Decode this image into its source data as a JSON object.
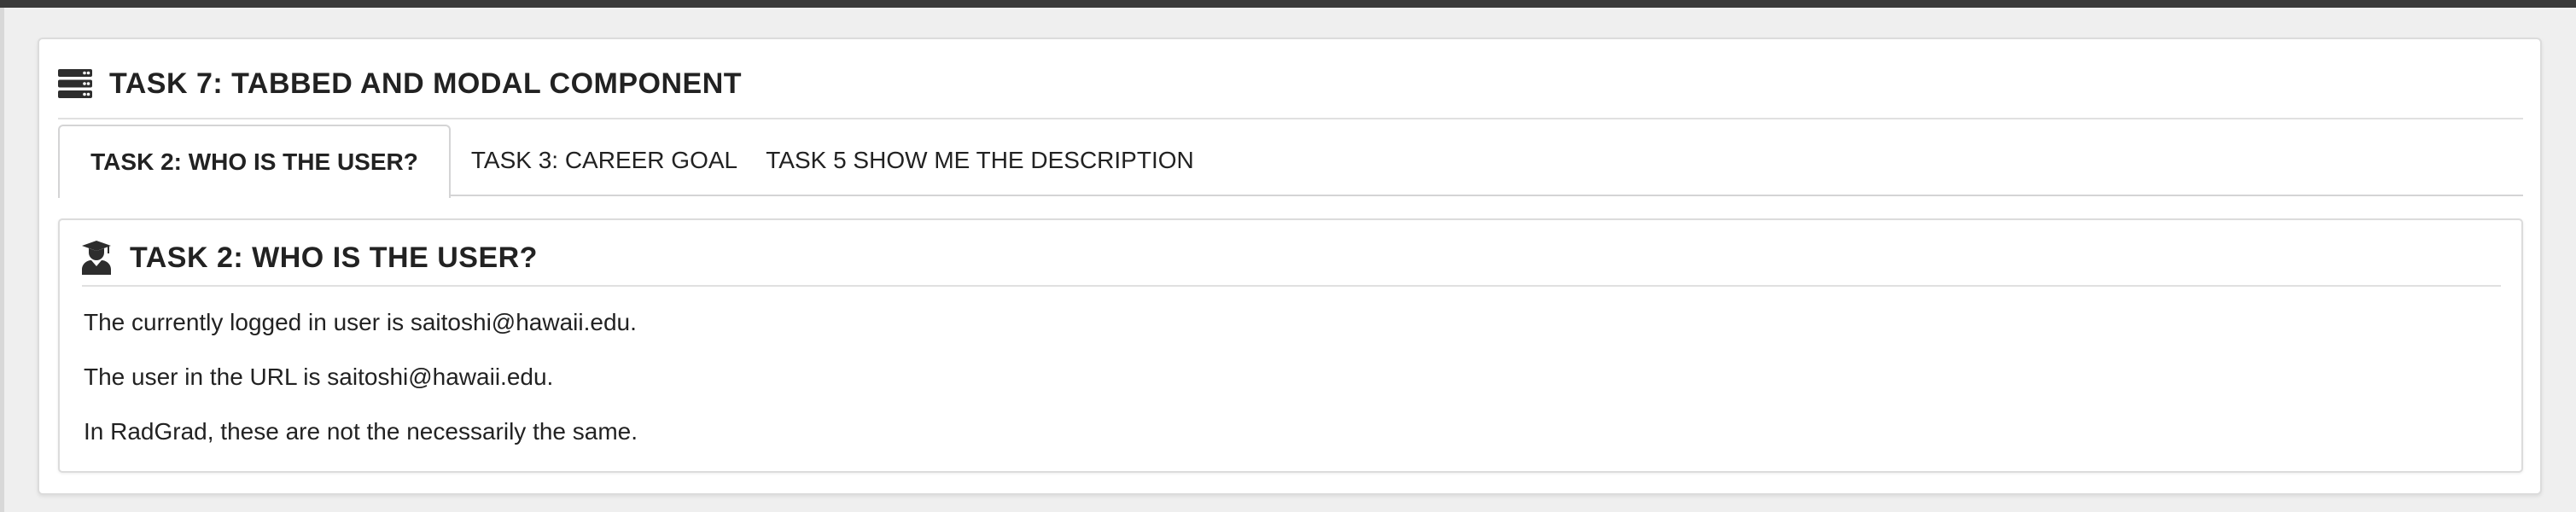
{
  "segment": {
    "title": "TASK 7: TABBED AND MODAL COMPONENT",
    "icon": "server-icon"
  },
  "tabs": [
    {
      "label": "TASK 2: WHO IS THE USER?",
      "active": true
    },
    {
      "label": "TASK 3: CAREER GOAL",
      "active": false
    },
    {
      "label": "TASK 5 SHOW ME THE DESCRIPTION",
      "active": false
    }
  ],
  "pane": {
    "title": "TASK 2: WHO IS THE USER?",
    "icon": "user-graduate-icon",
    "lines": [
      "The currently logged in user is saitoshi@hawaii.edu.",
      "The user in the URL is saitoshi@hawaii.edu.",
      "In RadGrad, these are not the necessarily the same."
    ]
  }
}
